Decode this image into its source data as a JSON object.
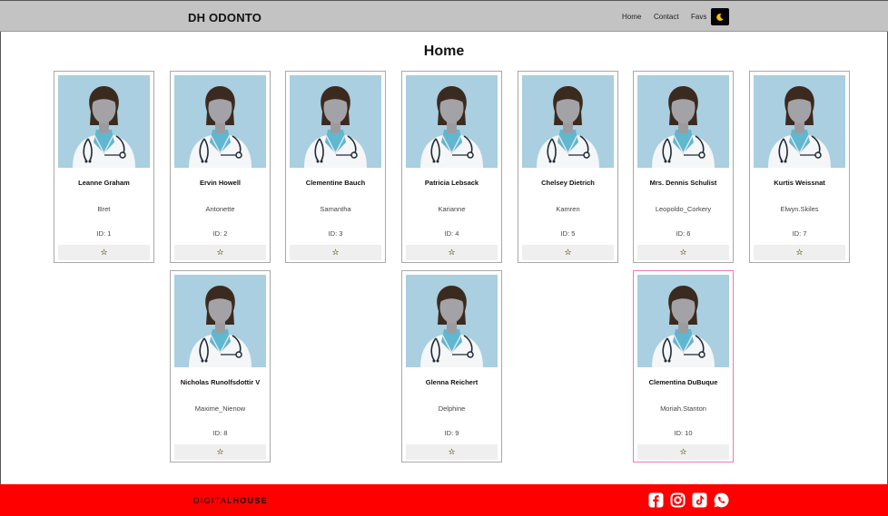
{
  "header": {
    "brand": "DH ODONTO",
    "nav": {
      "home": "Home",
      "contact": "Contact",
      "favs": "Favs"
    },
    "theme_toggle_icon": "moon-icon"
  },
  "main": {
    "title": "Home",
    "id_prefix": "ID: ",
    "fav_icon": "star-icon",
    "cards": [
      {
        "name": "Leanne Graham",
        "username": "Bret",
        "id_label": "ID: 1"
      },
      {
        "name": "Ervin Howell",
        "username": "Antonette",
        "id_label": "ID: 2"
      },
      {
        "name": "Clementine Bauch",
        "username": "Samantha",
        "id_label": "ID: 3"
      },
      {
        "name": "Patricia Lebsack",
        "username": "Karianne",
        "id_label": "ID: 4"
      },
      {
        "name": "Chelsey Dietrich",
        "username": "Kamren",
        "id_label": "ID: 5"
      },
      {
        "name": "Mrs. Dennis Schulist",
        "username": "Leopoldo_Corkery",
        "id_label": "ID: 6"
      },
      {
        "name": "Kurtis Weissnat",
        "username": "Elwyn.Skiles",
        "id_label": "ID: 7"
      },
      {
        "name": "Nicholas Runolfsdottir V",
        "username": "Maxime_Nienow",
        "id_label": "ID: 8"
      },
      {
        "name": "Glenna Reichert",
        "username": "Delphine",
        "id_label": "ID: 9"
      },
      {
        "name": "Clementina DuBuque",
        "username": "Moriah.Stanton",
        "id_label": "ID: 10"
      }
    ]
  },
  "footer": {
    "logo_light": "DIGITAL",
    "logo_bold": "HOUSE",
    "social": [
      "facebook-icon",
      "instagram-icon",
      "tiktok-icon",
      "whatsapp-icon"
    ]
  },
  "colors": {
    "header_bg": "#c4c3c4",
    "footer_bg": "#ff0000",
    "photo_bg": "#a9cfe0",
    "highlight_border": "#f07ab0",
    "star": "#d4a300"
  }
}
